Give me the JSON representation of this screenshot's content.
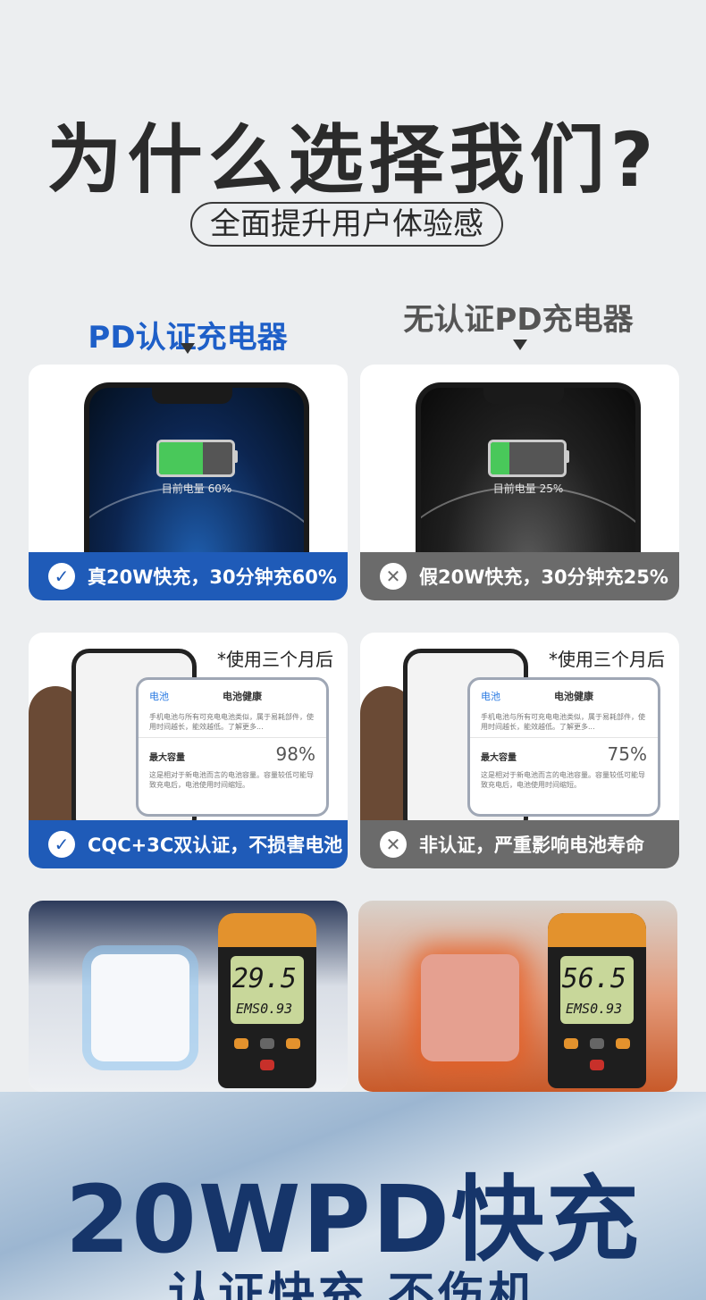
{
  "header": {
    "title": "为什么选择我们?",
    "subtitle": "全面提升用户体验感"
  },
  "columns": {
    "left": "PD认证充电器",
    "right": "无认证PD充电器"
  },
  "row1": {
    "left": {
      "battery_text": "目前电量 60%",
      "battery_level": 0.6,
      "caption": "真20W快充，30分钟充60%"
    },
    "right": {
      "battery_text": "目前电量 25%",
      "battery_level": 0.25,
      "caption": "假20W快充，30分钟充25%"
    }
  },
  "row2": {
    "left": {
      "note": "*使用三个月后",
      "back": "电池",
      "screen_title": "电池健康",
      "desc": "手机电池与所有可充电电池类似，属于易耗部件，使用时间越长，能效越低。了解更多...",
      "capacity_label": "最大容量",
      "capacity_value": "98%",
      "capacity_desc": "这是相对于新电池而言的电池容量。容量较低可能导致充电后，电池使用时间缩短。",
      "caption": "CQC+3C双认证，不损害电池"
    },
    "right": {
      "note": "*使用三个月后",
      "back": "电池",
      "screen_title": "电池健康",
      "desc": "手机电池与所有可充电电池类似，属于易耗部件，使用时间越长，能效越低。了解更多...",
      "capacity_label": "最大容量",
      "capacity_value": "75%",
      "capacity_desc": "这是相对于新电池而言的电池容量。容量较低可能导致充电后，电池使用时间缩短。",
      "caption": "非认证，严重影响电池寿命"
    }
  },
  "row3": {
    "left": {
      "temperature": "29.5",
      "ems": "EMS0.93"
    },
    "right": {
      "temperature": "56.5",
      "ems": "EMS0.93"
    }
  },
  "footer": {
    "headline": "20WPD快充",
    "tagline": "认证快充 不伤机"
  },
  "icons": {
    "check": "check-icon",
    "cross": "close-icon"
  },
  "colors": {
    "certified_blue": "#1f5bb8",
    "uncertified_gray": "#6b6b6b",
    "footer_text": "#16356a"
  }
}
